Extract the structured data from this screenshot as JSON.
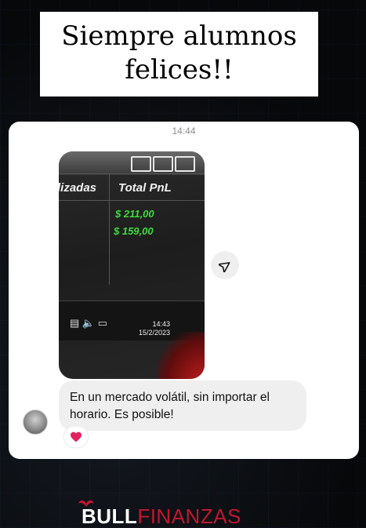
{
  "headline": {
    "line1": "Siempre alumnos",
    "line2": "felices!!"
  },
  "chat": {
    "timestamp": "14:44",
    "photo": {
      "col_left": "lizadas",
      "col_right": "Total PnL",
      "values": [
        "$ 211,00",
        "$ 159,00"
      ],
      "taskbar_time": "14:43",
      "taskbar_date": "15/2/2023"
    },
    "message": "En un mercado volátil, sin importar el horario. Es posible!",
    "reaction": "❤️"
  },
  "brand": {
    "part1": "BULL",
    "part2": "FINANZAS"
  },
  "colors": {
    "brand_red": "#c0172f",
    "pnl_green": "#3cdc3c",
    "heart": "#e0245e"
  }
}
